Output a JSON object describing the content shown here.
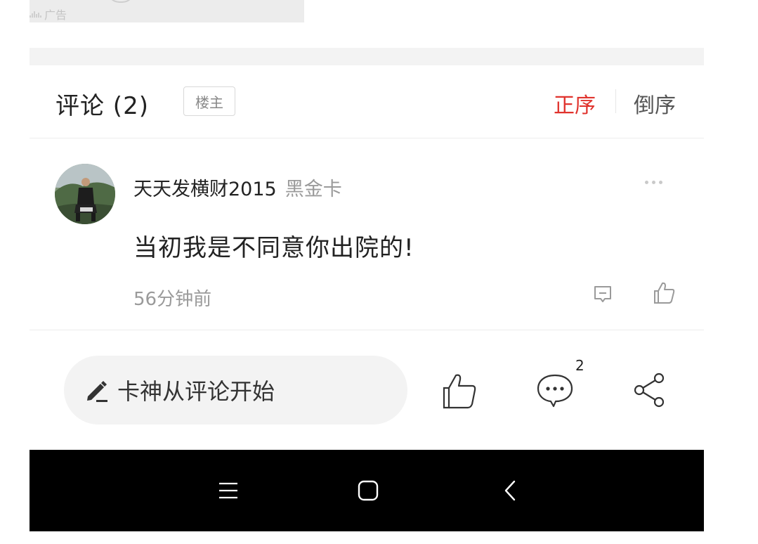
{
  "ad": {
    "label": "广告"
  },
  "comments_header": {
    "title": "评论 (2)",
    "owner_tag": "楼主",
    "sort_asc": "正序",
    "sort_desc": "倒序"
  },
  "comment": {
    "username": "天天发横财2015",
    "badge": "黑金卡",
    "text": "当初我是不同意你出院的!",
    "time": "56分钟前"
  },
  "action_bar": {
    "input_placeholder": "卡神从评论开始",
    "comment_count": "2"
  },
  "icons": {
    "more": "more-dots-icon",
    "reply": "reply-icon",
    "like": "thumbs-up-icon",
    "comment": "comment-bubble-icon",
    "share": "share-icon",
    "pencil": "pencil-icon",
    "nav_menu": "menu-icon",
    "nav_home": "home-icon",
    "nav_back": "back-icon"
  },
  "colors": {
    "accent": "#e0332d",
    "muted_text": "#9a9a9a",
    "nav_bar": "#000000"
  }
}
